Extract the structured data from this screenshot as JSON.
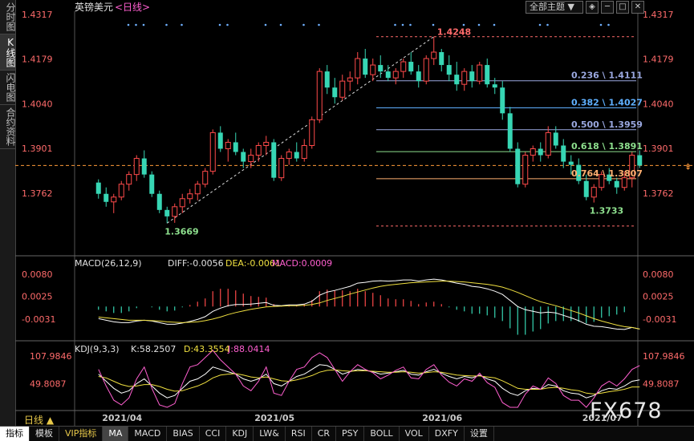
{
  "left_tabs": [
    "分时图",
    "K线图",
    "闪电图",
    "合约资料"
  ],
  "header": {
    "symbol": "英镑美元",
    "period": "<日线>",
    "theme": "全部主题",
    "theme_arrow": "▼"
  },
  "controls": [
    "◈",
    "─",
    "□",
    "✕"
  ],
  "watermark": "FX678",
  "period_tab": "日线 ▲",
  "bottom_tabs": [
    "指标",
    "模板",
    "VIP指标",
    "MA",
    "MACD",
    "BIAS",
    "CCI",
    "KDJ",
    "LW&",
    "RSI",
    "CR",
    "PSY",
    "BOLL",
    "VOL",
    "DXFY",
    "设置"
  ],
  "chart_data": {
    "type": "candlestick",
    "price_axis": {
      "ticks": [
        "1.4317",
        "1.4179",
        "1.4040",
        "1.3901",
        "1.3762"
      ],
      "ylim": [
        1.361,
        1.4317
      ]
    },
    "x_labels": [
      "2021/04",
      "2021/05",
      "2021/06",
      "2021/07"
    ],
    "annotations": {
      "high": "1.4248",
      "low1": "1.3669",
      "low2": "1.3733"
    },
    "fib_levels": [
      {
        "ratio": "0.236",
        "value": "1.4111",
        "color": "#9aa8e0"
      },
      {
        "ratio": "0.382",
        "value": "1.4027",
        "color": "#5fb0ff"
      },
      {
        "ratio": "0.500",
        "value": "1.3959",
        "color": "#9aa8e0"
      },
      {
        "ratio": "0.618",
        "value": "1.3891",
        "color": "#8ee08e"
      },
      {
        "ratio": "0.764",
        "value": "1.3807",
        "color": "#ffb070"
      }
    ],
    "fib_line_values": [
      1.4248,
      1.4111,
      1.4027,
      1.3959,
      1.3891,
      1.3807,
      1.366
    ],
    "current_price": 1.3848,
    "candles": [
      [
        1.3795,
        1.3805,
        1.3745,
        1.376
      ],
      [
        1.376,
        1.378,
        1.372,
        1.3735
      ],
      [
        1.3735,
        1.376,
        1.37,
        1.375
      ],
      [
        1.375,
        1.38,
        1.374,
        1.379
      ],
      [
        1.379,
        1.383,
        1.377,
        1.382
      ],
      [
        1.382,
        1.388,
        1.38,
        1.387
      ],
      [
        1.387,
        1.3895,
        1.381,
        1.382
      ],
      [
        1.382,
        1.383,
        1.375,
        1.376
      ],
      [
        1.376,
        1.377,
        1.37,
        1.371
      ],
      [
        1.371,
        1.372,
        1.3669,
        1.369
      ],
      [
        1.369,
        1.373,
        1.367,
        1.372
      ],
      [
        1.372,
        1.376,
        1.37,
        1.3745
      ],
      [
        1.3745,
        1.3775,
        1.373,
        1.376
      ],
      [
        1.376,
        1.38,
        1.374,
        1.379
      ],
      [
        1.379,
        1.384,
        1.378,
        1.383
      ],
      [
        1.383,
        1.396,
        1.382,
        1.395
      ],
      [
        1.395,
        1.397,
        1.389,
        1.39
      ],
      [
        1.39,
        1.393,
        1.386,
        1.392
      ],
      [
        1.392,
        1.395,
        1.388,
        1.389
      ],
      [
        1.389,
        1.39,
        1.384,
        1.386
      ],
      [
        1.386,
        1.39,
        1.384,
        1.388
      ],
      [
        1.388,
        1.392,
        1.386,
        1.391
      ],
      [
        1.391,
        1.394,
        1.388,
        1.392
      ],
      [
        1.392,
        1.393,
        1.38,
        1.381
      ],
      [
        1.381,
        1.388,
        1.38,
        1.387
      ],
      [
        1.387,
        1.39,
        1.385,
        1.389
      ],
      [
        1.389,
        1.392,
        1.386,
        1.387
      ],
      [
        1.387,
        1.393,
        1.386,
        1.391
      ],
      [
        1.391,
        1.4,
        1.39,
        1.399
      ],
      [
        1.399,
        1.415,
        1.398,
        1.414
      ],
      [
        1.414,
        1.416,
        1.407,
        1.409
      ],
      [
        1.409,
        1.412,
        1.404,
        1.406
      ],
      [
        1.406,
        1.413,
        1.405,
        1.411
      ],
      [
        1.411,
        1.414,
        1.408,
        1.412
      ],
      [
        1.412,
        1.42,
        1.41,
        1.418
      ],
      [
        1.418,
        1.421,
        1.412,
        1.413
      ],
      [
        1.413,
        1.418,
        1.411,
        1.416
      ],
      [
        1.416,
        1.419,
        1.412,
        1.414
      ],
      [
        1.414,
        1.416,
        1.411,
        1.412
      ],
      [
        1.412,
        1.415,
        1.41,
        1.414
      ],
      [
        1.414,
        1.418,
        1.412,
        1.417
      ],
      [
        1.417,
        1.42,
        1.413,
        1.414
      ],
      [
        1.414,
        1.416,
        1.409,
        1.411
      ],
      [
        1.411,
        1.419,
        1.41,
        1.418
      ],
      [
        1.418,
        1.4248,
        1.416,
        1.42
      ],
      [
        1.42,
        1.421,
        1.414,
        1.416
      ],
      [
        1.416,
        1.419,
        1.411,
        1.413
      ],
      [
        1.413,
        1.417,
        1.408,
        1.41
      ],
      [
        1.41,
        1.415,
        1.408,
        1.414
      ],
      [
        1.414,
        1.416,
        1.409,
        1.411
      ],
      [
        1.411,
        1.417,
        1.41,
        1.416
      ],
      [
        1.416,
        1.418,
        1.409,
        1.41
      ],
      [
        1.41,
        1.412,
        1.407,
        1.409
      ],
      [
        1.409,
        1.411,
        1.399,
        1.401
      ],
      [
        1.401,
        1.403,
        1.389,
        1.39
      ],
      [
        1.39,
        1.392,
        1.378,
        1.379
      ],
      [
        1.379,
        1.389,
        1.378,
        1.388
      ],
      [
        1.388,
        1.391,
        1.386,
        1.39
      ],
      [
        1.39,
        1.392,
        1.386,
        1.388
      ],
      [
        1.388,
        1.397,
        1.387,
        1.395
      ],
      [
        1.395,
        1.397,
        1.39,
        1.391
      ],
      [
        1.391,
        1.393,
        1.384,
        1.386
      ],
      [
        1.386,
        1.388,
        1.382,
        1.385
      ],
      [
        1.385,
        1.387,
        1.379,
        1.38
      ],
      [
        1.38,
        1.382,
        1.374,
        1.375
      ],
      [
        1.375,
        1.379,
        1.3733,
        1.378
      ],
      [
        1.378,
        1.383,
        1.377,
        1.382
      ],
      [
        1.382,
        1.384,
        1.379,
        1.38
      ],
      [
        1.38,
        1.381,
        1.376,
        1.378
      ],
      [
        1.378,
        1.383,
        1.377,
        1.381
      ],
      [
        1.381,
        1.389,
        1.378,
        1.388
      ],
      [
        1.388,
        1.3895,
        1.384,
        1.3848
      ]
    ],
    "macd": {
      "label": "MACD(26,12,9)",
      "diff_label": "DIFF:-0.0056",
      "dea_label": "DEA:-0.0061",
      "macd_label": "MACD:0.0009",
      "ticks": [
        "0.0080",
        "0.0025",
        "-0.0031"
      ],
      "ylim": [
        -0.0075,
        0.01
      ],
      "diff": [
        -0.003,
        -0.0034,
        -0.0038,
        -0.004,
        -0.004,
        -0.0036,
        -0.0034,
        -0.0036,
        -0.004,
        -0.0044,
        -0.0044,
        -0.0041,
        -0.0037,
        -0.0032,
        -0.0025,
        -0.0012,
        -0.0004,
        0.0002,
        0.0005,
        0.0005,
        0.0006,
        0.0008,
        0.001,
        0.0003,
        0.0002,
        0.0004,
        0.0004,
        0.0006,
        0.0013,
        0.0028,
        0.0036,
        0.004,
        0.0045,
        0.005,
        0.0058,
        0.006,
        0.0063,
        0.0064,
        0.0063,
        0.0064,
        0.0066,
        0.0066,
        0.0063,
        0.0066,
        0.0068,
        0.0066,
        0.0062,
        0.0058,
        0.0055,
        0.005,
        0.0048,
        0.0044,
        0.0038,
        0.003,
        0.0015,
        0.0,
        -0.0008,
        -0.0012,
        -0.0016,
        -0.0014,
        -0.0016,
        -0.0022,
        -0.0028,
        -0.0035,
        -0.0044,
        -0.0049,
        -0.005,
        -0.0053,
        -0.0056,
        -0.0057,
        -0.0052,
        -0.0056
      ],
      "dea": [
        -0.0026,
        -0.0028,
        -0.003,
        -0.0032,
        -0.0034,
        -0.0034,
        -0.0034,
        -0.0035,
        -0.0036,
        -0.0038,
        -0.0039,
        -0.004,
        -0.0039,
        -0.0038,
        -0.0035,
        -0.0031,
        -0.0026,
        -0.002,
        -0.0015,
        -0.0011,
        -0.0007,
        -0.0004,
        -0.0001,
        0.0,
        0.0001,
        0.0002,
        0.0002,
        0.0003,
        0.0005,
        0.0009,
        0.0015,
        0.002,
        0.0025,
        0.0031,
        0.0036,
        0.0041,
        0.0046,
        0.005,
        0.0053,
        0.0055,
        0.0057,
        0.0059,
        0.006,
        0.0061,
        0.0062,
        0.0063,
        0.0063,
        0.0062,
        0.0061,
        0.0059,
        0.0057,
        0.0055,
        0.0052,
        0.0048,
        0.0042,
        0.0035,
        0.0027,
        0.0019,
        0.0012,
        0.0007,
        0.0002,
        -0.0004,
        -0.001,
        -0.0016,
        -0.0023,
        -0.003,
        -0.0036,
        -0.0041,
        -0.0046,
        -0.005,
        -0.0052,
        -0.0056
      ]
    },
    "kdj": {
      "label": "KDJ(9,3,3)",
      "k_label": "K:58.2507",
      "d_label": "D:43.3554",
      "j_label": "J:88.0414",
      "ticks": [
        "107.9846",
        "49.8087"
      ],
      "ylim": [
        0,
        120
      ],
      "k": [
        70,
        55,
        40,
        30,
        35,
        50,
        60,
        45,
        30,
        20,
        25,
        40,
        55,
        60,
        70,
        85,
        80,
        75,
        70,
        60,
        55,
        60,
        70,
        50,
        45,
        55,
        65,
        70,
        80,
        90,
        88,
        80,
        70,
        75,
        80,
        78,
        75,
        70,
        72,
        75,
        78,
        70,
        68,
        75,
        80,
        72,
        65,
        60,
        65,
        62,
        68,
        60,
        55,
        40,
        30,
        25,
        35,
        40,
        38,
        48,
        45,
        35,
        30,
        28,
        20,
        25,
        35,
        40,
        38,
        45,
        55,
        58
      ],
      "d": [
        65,
        62,
        55,
        48,
        44,
        45,
        48,
        48,
        44,
        38,
        34,
        35,
        40,
        45,
        52,
        62,
        68,
        70,
        71,
        68,
        64,
        62,
        64,
        60,
        56,
        55,
        58,
        62,
        67,
        74,
        78,
        79,
        77,
        76,
        77,
        77,
        76,
        75,
        74,
        74,
        75,
        74,
        72,
        73,
        75,
        74,
        71,
        68,
        67,
        66,
        66,
        64,
        62,
        56,
        48,
        40,
        38,
        38,
        38,
        41,
        42,
        40,
        37,
        35,
        30,
        28,
        30,
        33,
        35,
        38,
        43,
        43
      ],
      "j": [
        80,
        45,
        15,
        5,
        20,
        60,
        85,
        40,
        5,
        0,
        8,
        50,
        85,
        90,
        105,
        120,
        100,
        85,
        70,
        45,
        35,
        55,
        85,
        30,
        25,
        55,
        80,
        85,
        105,
        115,
        105,
        80,
        55,
        75,
        90,
        80,
        73,
        60,
        68,
        78,
        85,
        62,
        60,
        80,
        90,
        68,
        53,
        45,
        60,
        55,
        72,
        52,
        42,
        10,
        0,
        0,
        28,
        45,
        38,
        62,
        50,
        25,
        15,
        15,
        0,
        20,
        45,
        55,
        45,
        60,
        80,
        88
      ]
    }
  }
}
